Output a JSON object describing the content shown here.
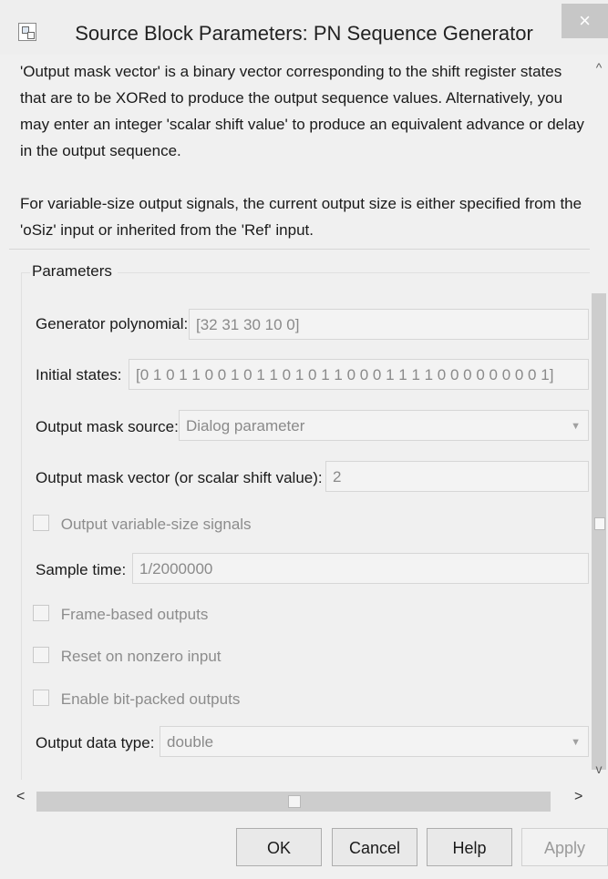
{
  "window": {
    "title": "Source Block Parameters: PN Sequence Generator",
    "close_label": "×"
  },
  "description": {
    "paragraph1": "'Output mask vector' is a binary vector corresponding to the shift register states that are to be XORed to produce the output sequence values. Alternatively, you may enter an integer 'scalar shift value' to produce an equivalent advance or delay in the output sequence.",
    "paragraph2": "For variable-size output signals, the current output size is either specified from the 'oSiz' input or inherited from the 'Ref' input."
  },
  "parameters": {
    "group_label": "Parameters",
    "generator_polynomial": {
      "label": "Generator polynomial:",
      "value": "[32 31 30 10 0]"
    },
    "initial_states": {
      "label": "Initial states:",
      "value": "[0 1 0 1 1 0 0 1 0 1 1 0 1 0 1 1 0 0 0 1 1 1 1 0 0 0 0 0 0 0 0 1]"
    },
    "output_mask_source": {
      "label": "Output mask source:",
      "value": "Dialog parameter"
    },
    "output_mask_vector": {
      "label": "Output mask vector (or scalar shift value):",
      "value": "2"
    },
    "output_variable_size": {
      "label": "Output variable-size signals",
      "checked": false
    },
    "sample_time": {
      "label": "Sample time:",
      "value": "1/2000000"
    },
    "frame_based": {
      "label": "Frame-based outputs",
      "checked": false
    },
    "reset_nonzero": {
      "label": "Reset on nonzero input",
      "checked": false
    },
    "bit_packed": {
      "label": "Enable bit-packed outputs",
      "checked": false
    },
    "output_data_type": {
      "label": "Output data type:",
      "value": "double"
    }
  },
  "scrollbars": {
    "up_arrow": "^",
    "down_arrow": "v",
    "left_arrow": "<",
    "right_arrow": ">"
  },
  "buttons": {
    "ok": "OK",
    "cancel": "Cancel",
    "help": "Help",
    "apply": "Apply"
  },
  "colors": {
    "window_bg": "#f0f0f0",
    "disabled_text": "#8a8a8a",
    "close_button": "#c7c7c7"
  }
}
